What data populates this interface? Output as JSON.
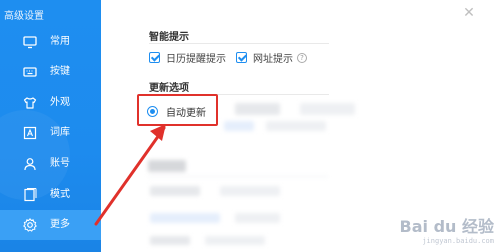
{
  "window": {
    "title": "高级设置"
  },
  "sidebar": {
    "items": [
      {
        "label": "常用",
        "icon": "monitor-icon"
      },
      {
        "label": "按键",
        "icon": "keyboard-icon"
      },
      {
        "label": "外观",
        "icon": "tshirt-icon"
      },
      {
        "label": "词库",
        "icon": "dictionary-icon"
      },
      {
        "label": "账号",
        "icon": "user-icon"
      },
      {
        "label": "模式",
        "icon": "mode-icon"
      },
      {
        "label": "更多",
        "icon": "gear-icon"
      }
    ],
    "active_index": 6
  },
  "sections": {
    "smart_tips": {
      "title": "智能提示",
      "options": [
        {
          "label": "日历提醒提示",
          "checked": true
        },
        {
          "label": "网址提示",
          "checked": true
        }
      ],
      "help_glyph": "?"
    },
    "update": {
      "title": "更新选项",
      "radio_label": "自动更新",
      "selected": true
    }
  },
  "watermark": {
    "logo": "Bai du 经验",
    "sub": "jingyan.baidu.com"
  },
  "colors": {
    "sidebar_bg": "#1e8ef0",
    "active_item": "#3aa0f5",
    "accent": "#1e8ef0",
    "annotation": "#e0312b"
  }
}
